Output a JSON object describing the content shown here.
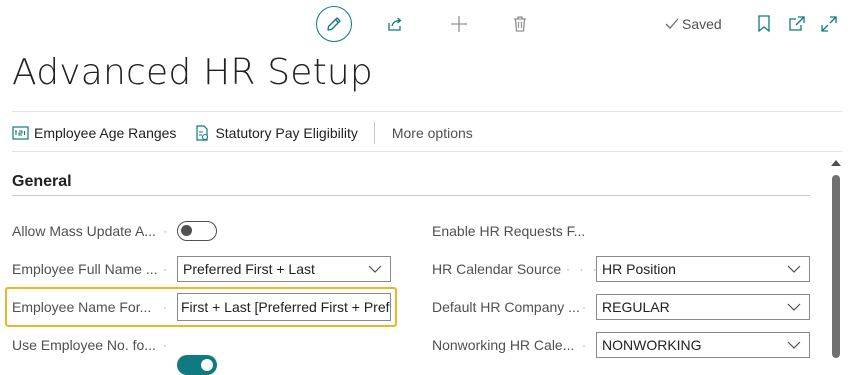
{
  "toolbar": {
    "edit_icon": "pencil-icon",
    "share_icon": "share-icon",
    "new_icon": "plus-icon",
    "delete_icon": "trash-icon",
    "saved_label": "Saved",
    "bookmark_icon": "bookmark-icon",
    "open_new_window_icon": "open-new-window-icon",
    "expand_icon": "expand-icon"
  },
  "page": {
    "title": "Advanced HR Setup"
  },
  "actions": [
    {
      "label": "Employee Age Ranges",
      "icon": "ranges-icon"
    },
    {
      "label": "Statutory Pay Eligibility",
      "icon": "eligibility-icon"
    }
  ],
  "more_options_label": "More options",
  "section": {
    "title": "General"
  },
  "left_fields": [
    {
      "label": "Allow Mass Update A...",
      "type": "toggle",
      "value": false
    },
    {
      "label": "Employee Full Name ...",
      "type": "select",
      "value": "Preferred First + Last"
    },
    {
      "label": "Employee Name For...",
      "type": "text",
      "value": "First + Last [Preferred First + Preferred Last]"
    },
    {
      "label": "Use Employee No. fo...",
      "type": "toggle",
      "value": true
    }
  ],
  "right_fields": [
    {
      "label": "Enable HR Requests F...",
      "type": "toggle",
      "value": true
    },
    {
      "label": "HR Calendar Source",
      "type": "select",
      "value": "HR Position"
    },
    {
      "label": "Default HR Company ...",
      "type": "select",
      "value": "REGULAR"
    },
    {
      "label": "Nonworking HR Cale...",
      "type": "select",
      "value": "NONWORKING"
    }
  ],
  "colors": {
    "accent": "#0f7b80",
    "focus": "#f0b429"
  }
}
